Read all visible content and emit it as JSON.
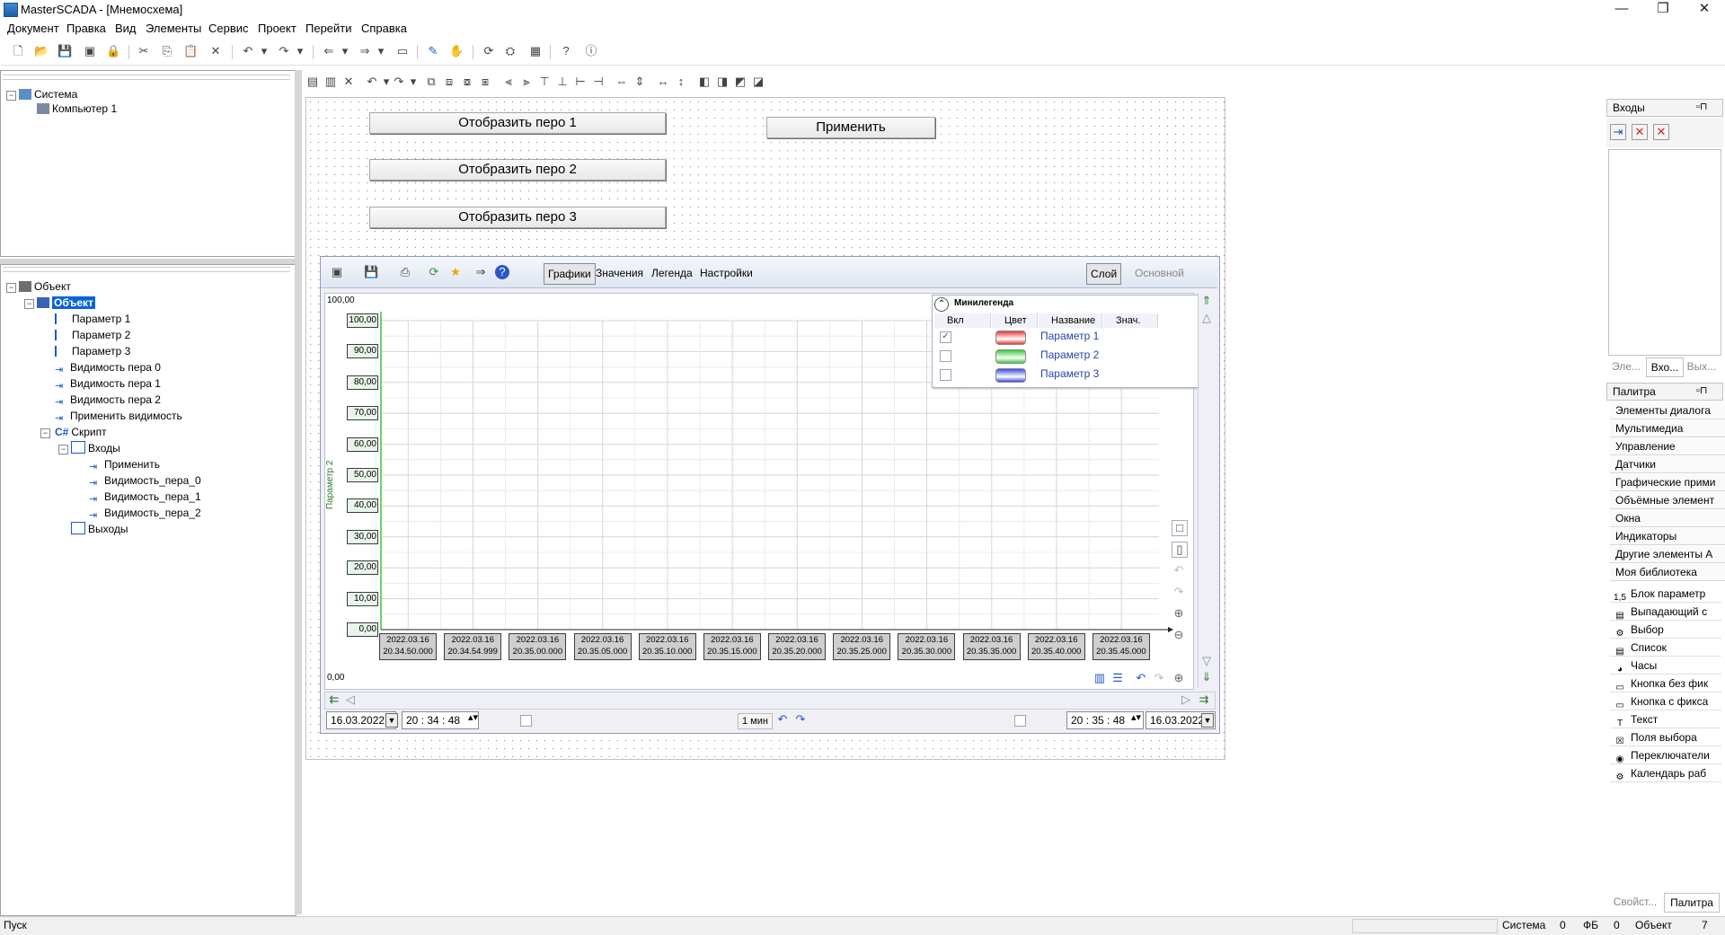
{
  "window": {
    "title": "MasterSCADA - [Мнемосхема]",
    "minimize": "—",
    "restore": "❐",
    "close": "✕"
  },
  "menu": [
    "Документ",
    "Правка",
    "Вид",
    "Элементы",
    "Сервис",
    "Проект",
    "Перейти",
    "Справка"
  ],
  "system_tree": {
    "root": "Система",
    "child": "Компьютер 1"
  },
  "object_tree": {
    "root": "Объект",
    "selected": "Объект",
    "items": [
      "Параметр 1",
      "Параметр 2",
      "Параметр 3",
      "Видимость пера 0",
      "Видимость пера 1",
      "Видимость пера 2",
      "Применить видимость"
    ],
    "script": "Скрипт",
    "script_lang": "C#",
    "inputs": "Входы",
    "input_items": [
      "Применить",
      "Видимость_пера_0",
      "Видимость_пера_1",
      "Видимость_пера_2"
    ],
    "outputs": "Выходы"
  },
  "canvas_buttons": {
    "pen1": "Отобразить перо 1",
    "pen2": "Отобразить перо 2",
    "pen3": "Отобразить перо 3",
    "apply": "Применить"
  },
  "trend": {
    "tabs": [
      "Графики",
      "Значения",
      "Легенда",
      "Настройки"
    ],
    "active_tab": "Графики",
    "layer_button": "Слой",
    "layer_value": "Основной",
    "top_value": "100,00",
    "bottom_value": "0,00",
    "y_axis_title": "Параметр 2",
    "minilegend": {
      "title": "Минилегенда",
      "headers": [
        "Вкл",
        "Цвет",
        "Название",
        "Знач."
      ],
      "rows": [
        {
          "name": "Параметр 1",
          "checked": true,
          "color": "#e83a3a"
        },
        {
          "name": "Параметр 2",
          "checked": false,
          "color": "#3acb3a"
        },
        {
          "name": "Параметр 3",
          "checked": false,
          "color": "#3a4be8"
        }
      ]
    },
    "bottom": {
      "date_start": "16.03.2022",
      "time_start": "20 : 34 : 48",
      "interval": "1 мин",
      "time_end": "20 : 35 : 48",
      "date_end": "16.03.2022"
    }
  },
  "chart_data": {
    "type": "line",
    "ylim": [
      0,
      100
    ],
    "y_ticks": [
      "0,00",
      "10,00",
      "20,00",
      "30,00",
      "40,00",
      "50,00",
      "60,00",
      "70,00",
      "80,00",
      "90,00",
      "100,00"
    ],
    "x_ticks": [
      [
        "2022.03.16",
        "20.34.50.000"
      ],
      [
        "2022.03.16",
        "20.34.54.999"
      ],
      [
        "2022.03.16",
        "20.35.00.000"
      ],
      [
        "2022.03.16",
        "20.35.05.000"
      ],
      [
        "2022.03.16",
        "20.35.10.000"
      ],
      [
        "2022.03.16",
        "20.35.15.000"
      ],
      [
        "2022.03.16",
        "20.35.20.000"
      ],
      [
        "2022.03.16",
        "20.35.25.000"
      ],
      [
        "2022.03.16",
        "20.35.30.000"
      ],
      [
        "2022.03.16",
        "20.35.35.000"
      ],
      [
        "2022.03.16",
        "20.35.40.000"
      ],
      [
        "2022.03.16",
        "20.35.45.000"
      ]
    ],
    "grid": true,
    "series": []
  },
  "right_panel": {
    "inputs_title": "Входы",
    "tabs": [
      "Эле...",
      "Вхо...",
      "Вых..."
    ],
    "palette_title": "Палитра",
    "groups": [
      "Элементы диалога",
      "Мультимедиа",
      "Управление",
      "Датчики",
      "Графические прими",
      "Объёмные элемент",
      "Окна",
      "Индикаторы",
      "Другие элементы А",
      "Моя библиотека"
    ],
    "elements": [
      {
        "label": "Блок параметр",
        "icon": "1,5"
      },
      {
        "label": "Выпадающий с",
        "icon": "▤"
      },
      {
        "label": "Выбор",
        "icon": "⚙"
      },
      {
        "label": "Список",
        "icon": "▤"
      },
      {
        "label": "Часы",
        "icon": "◕"
      },
      {
        "label": "Кнопка без фик",
        "icon": "▭"
      },
      {
        "label": "Кнопка с фикса",
        "icon": "▭"
      },
      {
        "label": "Текст",
        "icon": "T"
      },
      {
        "label": "Поля выбора",
        "icon": "☒"
      },
      {
        "label": "Переключатели",
        "icon": "◉"
      },
      {
        "label": "Календарь раб",
        "icon": "⚙"
      }
    ],
    "bottom_tabs": [
      "Свойст...",
      "Палитра"
    ]
  },
  "status": {
    "left": "Пуск",
    "system_label": "Система",
    "system_value": "0",
    "fb_label": "ФБ",
    "fb_value": "0",
    "object_label": "Объект",
    "object_value": "7"
  }
}
